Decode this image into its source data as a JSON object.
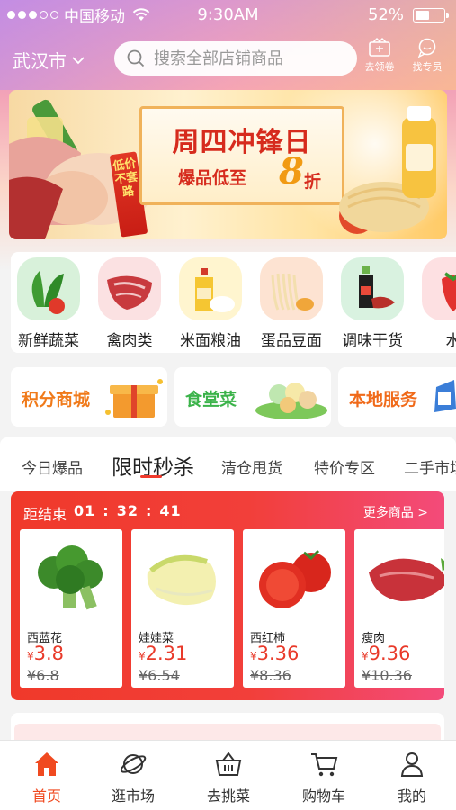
{
  "status_bar": {
    "carrier": "中国移动",
    "time": "9:30AM",
    "battery": "52%",
    "battery_level": 0.52,
    "signal_bars_filled": 3,
    "signal_bars_total": 5
  },
  "header": {
    "city": "武汉市",
    "search_placeholder": "搜索全部店铺商品",
    "coupon_label": "去领卷",
    "expert_label": "找专员"
  },
  "banner": {
    "title": "周四冲锋日",
    "sub_prefix": "爆品低至",
    "discount": "8",
    "sub_suffix": "折",
    "ribbon": "低价不套路"
  },
  "categories": [
    {
      "label": "新鲜蔬菜"
    },
    {
      "label": "禽肉类"
    },
    {
      "label": "米面粮油"
    },
    {
      "label": "蛋品豆面"
    },
    {
      "label": "调味干货"
    },
    {
      "label": "水"
    }
  ],
  "promos": [
    {
      "label": "积分商城"
    },
    {
      "label": "食堂菜"
    },
    {
      "label": "本地服务"
    }
  ],
  "tabs": [
    {
      "label": "今日爆品"
    },
    {
      "label": "限时秒杀"
    },
    {
      "label": "清仓甩货"
    },
    {
      "label": "特价专区"
    },
    {
      "label": "二手市场"
    }
  ],
  "flash_sale": {
    "countdown_label": "距结束",
    "hours": "01",
    "minutes": "32",
    "seconds": "41",
    "more_label": "更多商品 >",
    "currency": "¥",
    "products": [
      {
        "name": "西蓝花",
        "price": "3.8",
        "old_price": "¥6.8"
      },
      {
        "name": "娃娃菜",
        "price": "2.31",
        "old_price": "¥6.54"
      },
      {
        "name": "西红柿",
        "price": "3.36",
        "old_price": "¥8.36"
      },
      {
        "name": "瘦肉",
        "price": "9.36",
        "old_price": "¥10.36"
      }
    ]
  },
  "bottom_nav": [
    {
      "label": "首页"
    },
    {
      "label": "逛市场"
    },
    {
      "label": "去挑菜"
    },
    {
      "label": "购物车"
    },
    {
      "label": "我的"
    }
  ],
  "colors": {
    "accent": "#f03a2c",
    "nav_active": "#f04a20",
    "price": "#e93a2a"
  }
}
